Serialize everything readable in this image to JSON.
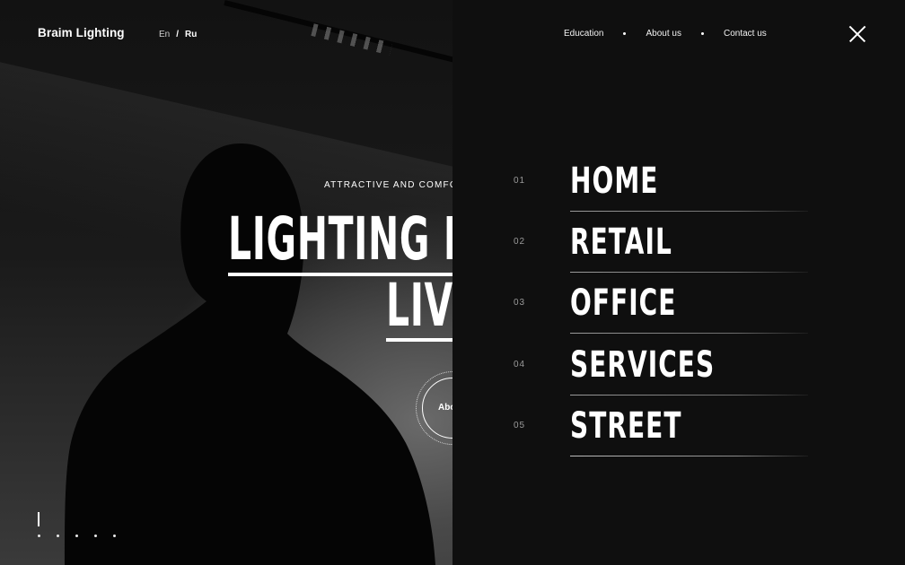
{
  "brand": {
    "name": "Braim Lighting"
  },
  "language": {
    "en": "En",
    "separator": "/",
    "ru": "Ru"
  },
  "hero": {
    "tagline": "ATTRACTIVE AND COMFO",
    "headline_line1": "LIGHTING D",
    "headline_line2": "LIV",
    "about_button": "Abo",
    "slides": {
      "count": 5
    }
  },
  "topnav": {
    "items": [
      "Education",
      "About us",
      "Contact us"
    ]
  },
  "close_icon": "close-icon",
  "menu": {
    "items": [
      {
        "num": "01",
        "label": "HOME"
      },
      {
        "num": "02",
        "label": "RETAIL"
      },
      {
        "num": "03",
        "label": "OFFICE"
      },
      {
        "num": "04",
        "label": "SERVICES"
      },
      {
        "num": "05",
        "label": "STREET"
      }
    ]
  }
}
